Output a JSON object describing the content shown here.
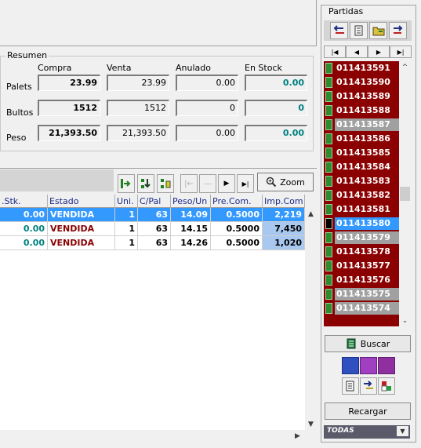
{
  "resumen": {
    "title": "Resumen",
    "headers": [
      "Compra",
      "Venta",
      "Anulado",
      "En Stock"
    ],
    "rows": [
      {
        "label": "Palets",
        "values": [
          "23.99",
          "23.99",
          "0.00",
          "0.00"
        ]
      },
      {
        "label": "Bultos",
        "values": [
          "1512",
          "1512",
          "0",
          "0"
        ]
      },
      {
        "label": "Peso",
        "values": [
          "21,393.50",
          "21,393.50",
          "0.00",
          "0.00"
        ]
      }
    ]
  },
  "toolbar": {
    "zoom_label": "Zoom"
  },
  "grid": {
    "headers": [
      ".Stk.",
      "Estado",
      "Uni.",
      "C/Pal",
      "Peso/Un",
      "Pre.Com.",
      "Imp.Com"
    ],
    "rows": [
      [
        ".0.00",
        "VENDIDA",
        "1",
        "63",
        "14.09",
        "0.5000",
        "2,219"
      ],
      [
        "0.00",
        "VENDIDA",
        "1",
        "63",
        "14.15",
        "0.5000",
        "7,450"
      ],
      [
        "0.00",
        "VENDIDA",
        "1",
        "63",
        "14.26",
        "0.5000",
        "1,020"
      ]
    ]
  },
  "partidas": {
    "title": "Partidas",
    "items": [
      "011413591",
      "011413590",
      "011413589",
      "011413588",
      "011413587",
      "011413586",
      "011413585",
      "011413584",
      "011413583",
      "011413582",
      "011413581",
      "011413580",
      "011413579",
      "011413578",
      "011413577",
      "011413576",
      "011413575",
      "011413574"
    ],
    "selected": "011413580",
    "gray_items": [
      "011413587",
      "011413579",
      "011413575",
      "011413574"
    ]
  },
  "buttons": {
    "buscar": "Buscar",
    "recargar": "Recargar"
  },
  "filter": {
    "selected": "TODAS"
  },
  "colors": {
    "dark_red": "#8b0000",
    "teal": "#008080",
    "selection_blue": "#3399ff"
  }
}
